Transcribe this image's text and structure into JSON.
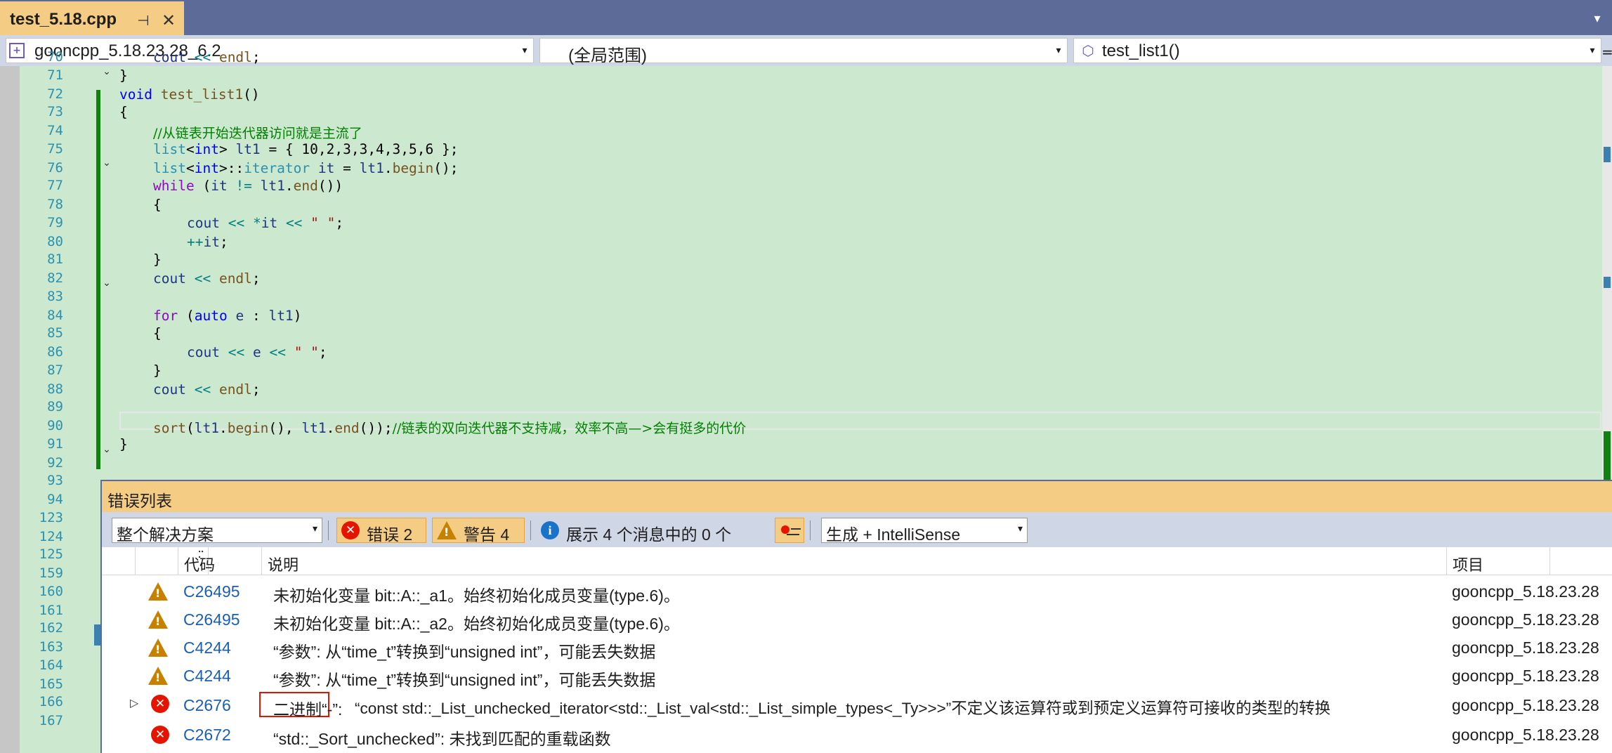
{
  "tab": {
    "title": "test_5.18.cpp",
    "pin": "⊣",
    "close": "✕",
    "overflow": "▾"
  },
  "nav": {
    "project": "gooncpp_5.18.23.28_6.2",
    "scope": "(全局范围)",
    "member": "test_list1()",
    "arrow": "▾"
  },
  "line_numbers": [
    "70",
    "71",
    "72",
    "73",
    "74",
    "75",
    "76",
    "77",
    "78",
    "79",
    "80",
    "81",
    "82",
    "83",
    "84",
    "85",
    "86",
    "87",
    "88",
    "89",
    "90",
    "91",
    "92",
    "93",
    "94",
    "123",
    "124",
    "125",
    "159",
    "160",
    "161",
    "162",
    "163",
    "164",
    "165",
    "166",
    "167"
  ],
  "code": {
    "l70": [
      "cout",
      "<<",
      "endl",
      ";"
    ],
    "l71": "}",
    "l72": [
      "void",
      "test_list1",
      "()"
    ],
    "l73": "{",
    "l74": "//从链表开始迭代器访问就是主流了",
    "l75": [
      "list",
      "<",
      "int",
      ">",
      "lt1",
      "= { 10,2,3,3,4,3,5,6 };"
    ],
    "l76": [
      "list",
      "<",
      "int",
      ">::",
      "iterator",
      "it",
      "=",
      "lt1",
      ".",
      "begin",
      "();"
    ],
    "l77": [
      "while",
      "(",
      "it",
      "!=",
      "lt1",
      ".",
      "end",
      "())"
    ],
    "l78": "{",
    "l79": [
      "cout",
      "<<",
      "*",
      "it",
      "<<",
      "\" \"",
      ";"
    ],
    "l80": [
      "++",
      "it",
      ";"
    ],
    "l81": "}",
    "l82": [
      "cout",
      "<<",
      "endl",
      ";"
    ],
    "l84": [
      "for",
      "(",
      "auto",
      "e",
      ":",
      "lt1",
      ")"
    ],
    "l85": "{",
    "l86": [
      "cout",
      "<<",
      "e",
      "<<",
      "\" \"",
      ";"
    ],
    "l87": "}",
    "l88": [
      "cout",
      "<<",
      "endl",
      ";"
    ],
    "l90": [
      "sort",
      "(",
      "lt1",
      ".",
      "begin",
      "(),",
      "lt1",
      ".",
      "end",
      "());",
      "//链表的双向迭代器不支持减，效率不高—>会有挺多的代价"
    ],
    "l91": "}"
  },
  "errorlist": {
    "title": "错误列表",
    "scope_filter": "整个解决方案",
    "errors_btn": "错误 2",
    "warnings_btn": "警告 4",
    "messages_btn": "展示 4 个消息中的 0 个",
    "build_filter": "生成 + IntelliSense",
    "columns": {
      "code": "代码",
      "desc": "说明",
      "project": "项目"
    },
    "rows": [
      {
        "type": "warning",
        "code": "C26495",
        "desc": "未初始化变量 bit::A::_a1。始终初始化成员变量(type.6)。",
        "project": "gooncpp_5.18.23.28"
      },
      {
        "type": "warning",
        "code": "C26495",
        "desc": "未初始化变量 bit::A::_a2。始终初始化成员变量(type.6)。",
        "project": "gooncpp_5.18.23.28"
      },
      {
        "type": "warning",
        "code": "C4244",
        "desc": "“参数”: 从“time_t”转换到“unsigned int”，可能丢失数据",
        "project": "gooncpp_5.18.23.28"
      },
      {
        "type": "warning",
        "code": "C4244",
        "desc": "“参数”: 从“time_t”转换到“unsigned int”，可能丢失数据",
        "project": "gooncpp_5.18.23.28"
      },
      {
        "type": "error",
        "code": "C2676",
        "desc_highlight": "二进制“-”:",
        "desc": "“const std::_List_unchecked_iterator<std::_List_val<std::_List_simple_types<_Ty>>>”不定义该运算符或到预定义运算符可接收的类型的转换",
        "project": "gooncpp_5.18.23.28"
      },
      {
        "type": "error",
        "code": "C2672",
        "desc": "“std::_Sort_unchecked”: 未找到匹配的重载函数",
        "project": "gooncpp_5.18.23.28"
      }
    ]
  }
}
